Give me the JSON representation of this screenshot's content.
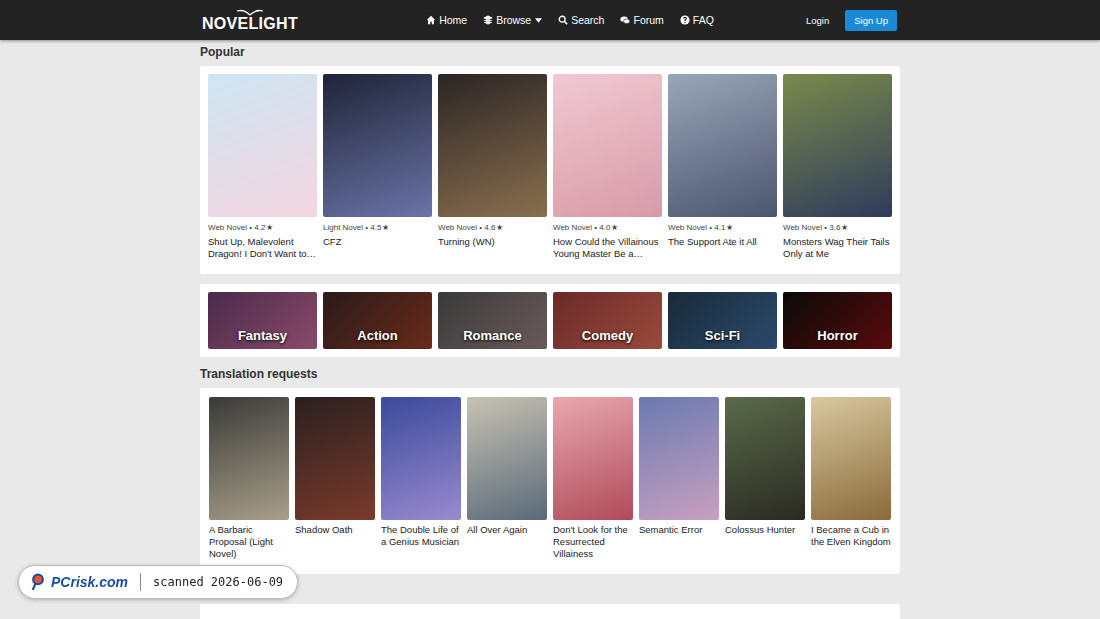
{
  "nav": {
    "logo": "NOVELIGHT",
    "items": [
      {
        "label": "Home",
        "kind": "link"
      },
      {
        "label": "Browse",
        "kind": "dropdown"
      },
      {
        "label": "Search",
        "kind": "link"
      },
      {
        "label": "Forum",
        "kind": "link"
      },
      {
        "label": "FAQ",
        "kind": "link"
      }
    ],
    "login": "Login",
    "signup": "Sign Up"
  },
  "meta_separator": "•",
  "star_glyph": "★",
  "popular": {
    "title": "Popular",
    "items": [
      {
        "type": "Web Novel",
        "rating": "4.2",
        "title": "Shut Up, Malevolent Dragon! I Don't Want to…"
      },
      {
        "type": "Light Novel",
        "rating": "4.5",
        "title": "CFZ"
      },
      {
        "type": "Web Novel",
        "rating": "4.6",
        "title": "Turning (WN)"
      },
      {
        "type": "Web Novel",
        "rating": "4.0",
        "title": "How Could the Villainous Young Master Be a…"
      },
      {
        "type": "Web Novel",
        "rating": "4.1",
        "title": "The Support Ate it All"
      },
      {
        "type": "Web Novel",
        "rating": "3.6",
        "title": "Monsters Wag Their Tails Only at Me"
      }
    ]
  },
  "genres": [
    "Fantasy",
    "Action",
    "Romance",
    "Comedy",
    "Sci-Fi",
    "Horror"
  ],
  "requests": {
    "title": "Translation requests",
    "items": [
      {
        "title": "A Barbaric Proposal (Light Novel)"
      },
      {
        "title": "Shadow Oath"
      },
      {
        "title": "The Double Life of a Genius Musician"
      },
      {
        "title": "All Over Again"
      },
      {
        "title": "Don't Look for the Resurrected Villainess"
      },
      {
        "title": "Semantic Error"
      },
      {
        "title": "Colossus Hunter"
      },
      {
        "title": "I Became a Cub in the Elven Kingdom"
      }
    ]
  },
  "watermark": {
    "brand": "PCrisk.com",
    "text": "scanned 2026-06-09"
  }
}
